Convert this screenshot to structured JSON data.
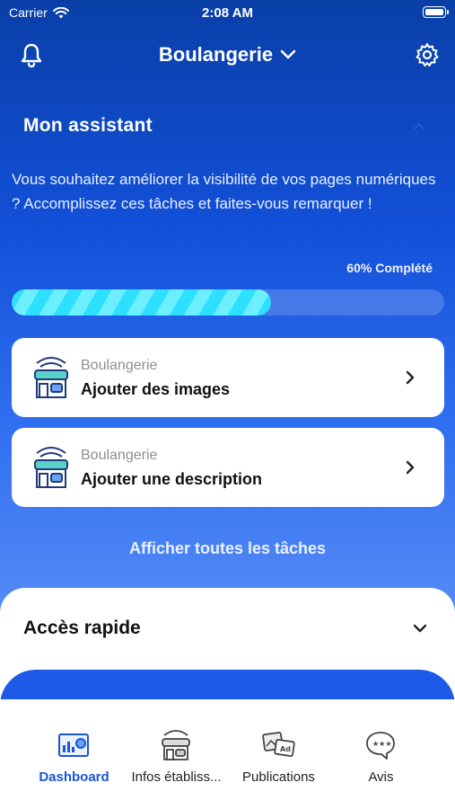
{
  "status": {
    "carrier": "Carrier",
    "time": "2:08 AM"
  },
  "header": {
    "title": "Boulangerie"
  },
  "assistant": {
    "title": "Mon assistant",
    "description": "Vous souhaitez améliorer la visibilité de vos pages numériques ? Accomplissez ces tâches et faites-vous remarquer !",
    "progress_label": "60% Complété",
    "progress": 0.6
  },
  "tasks": [
    {
      "category": "Boulangerie",
      "label": "Ajouter des images"
    },
    {
      "category": "Boulangerie",
      "label": "Ajouter une description"
    }
  ],
  "show_all_label": "Afficher toutes les tâches",
  "quick_access": {
    "title": "Accès rapide"
  },
  "tabs": [
    {
      "label": "Dashboard",
      "icon": "dashboard-icon",
      "active": true
    },
    {
      "label": "Infos établiss...",
      "icon": "store-icon",
      "active": false
    },
    {
      "label": "Publications",
      "icon": "publications-icon",
      "active": false
    },
    {
      "label": "Avis",
      "icon": "reviews-icon",
      "active": false
    }
  ],
  "colors": {
    "accent": "#1a56d8",
    "progress": "#2ee0ff"
  }
}
